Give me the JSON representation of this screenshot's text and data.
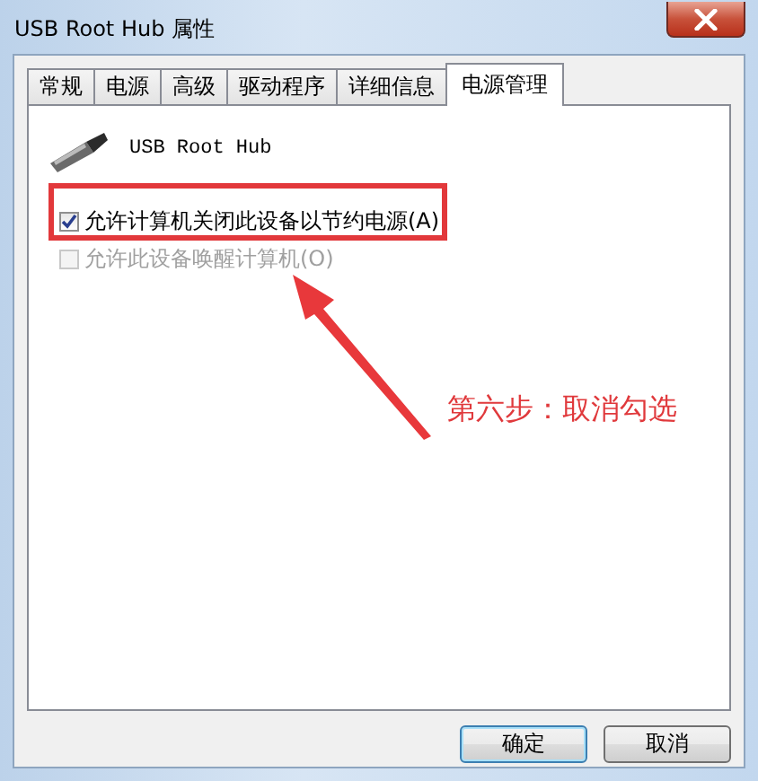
{
  "window": {
    "title": "USB Root Hub 属性"
  },
  "tabs": [
    {
      "label": "常规",
      "selected": false
    },
    {
      "label": "电源",
      "selected": false
    },
    {
      "label": "高级",
      "selected": false
    },
    {
      "label": "驱动程序",
      "selected": false
    },
    {
      "label": "详细信息",
      "selected": false
    },
    {
      "label": "电源管理",
      "selected": true
    }
  ],
  "device": {
    "name": "USB Root Hub"
  },
  "options": [
    {
      "label": "允许计算机关闭此设备以节约电源(A)",
      "checked": true,
      "disabled": false
    },
    {
      "label": "允许此设备唤醒计算机(O)",
      "checked": false,
      "disabled": true
    }
  ],
  "annotation": {
    "text": "第六步：取消勾选"
  },
  "buttons": [
    "确定",
    "取消"
  ]
}
